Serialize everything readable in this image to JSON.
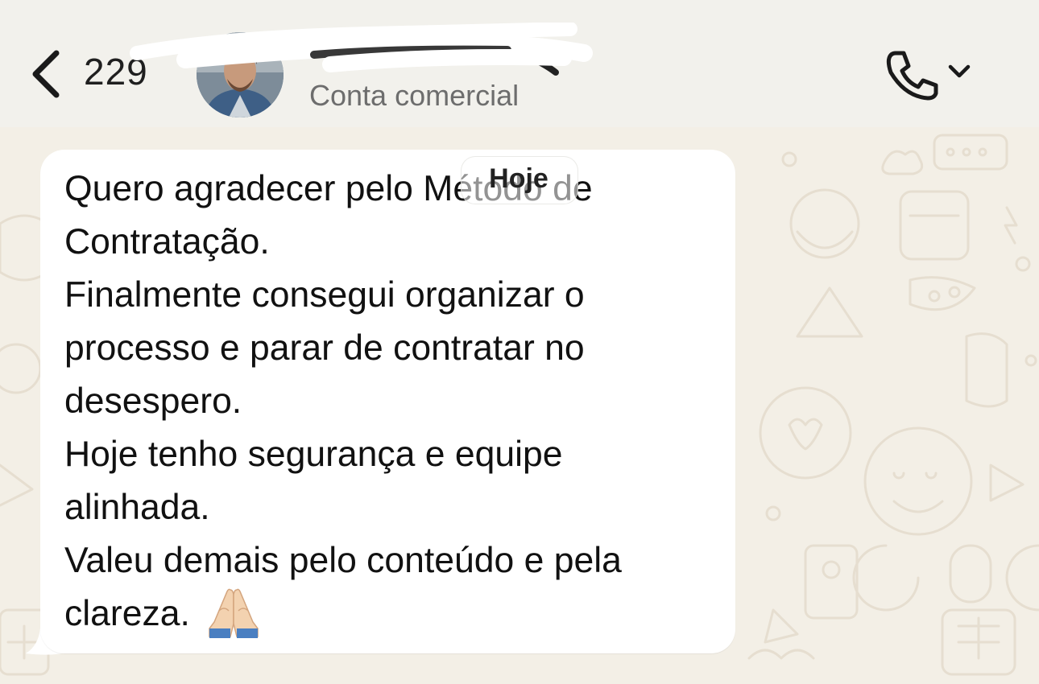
{
  "header": {
    "back_count": "229",
    "contact_subtitle": "Conta comercial",
    "icons": {
      "back": "chevron-left-icon",
      "call": "phone-icon",
      "call_menu": "chevron-down-icon"
    }
  },
  "date_separator": "Hoje",
  "message": {
    "text": "Quero agradecer pelo Método de\nContratação.\nFinalmente consegui organizar o\nprocesso e parar de contratar no\ndesespero.\nHoje tenho segurança e equipe\nalinhada.\nValeu demais pelo conteúdo e pela\nclareza.",
    "emoji": "folded-hands-emoji"
  },
  "colors": {
    "header_bg": "#f2f1ec",
    "chat_bg": "#f3efe6",
    "bubble_bg": "#ffffff",
    "text": "#111111",
    "subtitle": "#6d6d6d"
  }
}
